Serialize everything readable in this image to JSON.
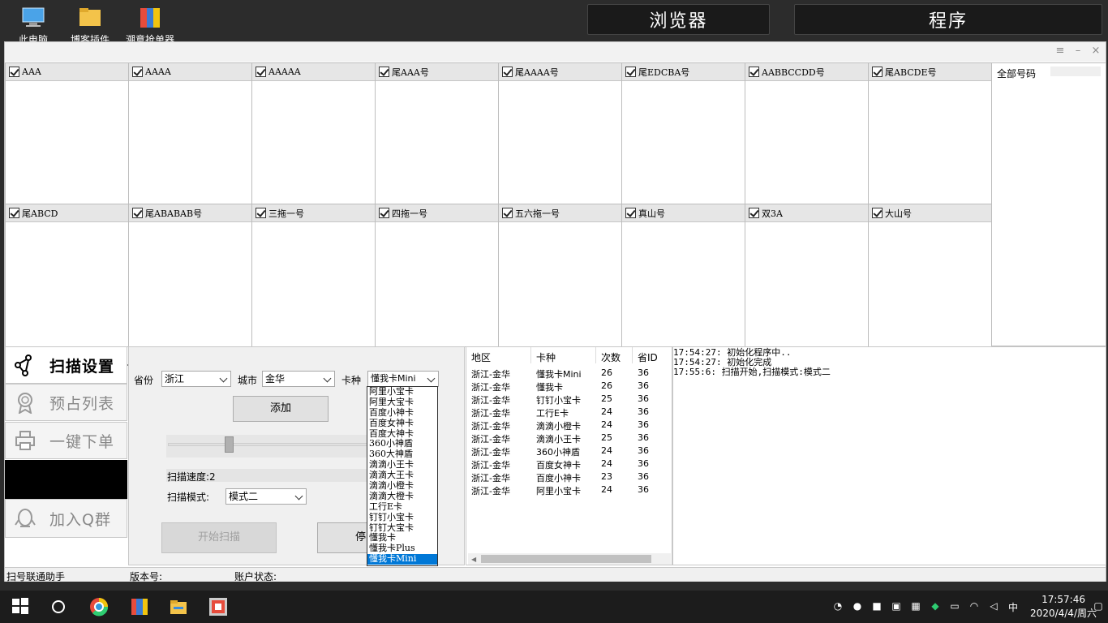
{
  "desktop": {
    "icons": [
      {
        "label": "此电脑",
        "icon": "computer-icon"
      },
      {
        "label": "博客插件",
        "icon": "folder-icon"
      },
      {
        "label": "溯意抢单器",
        "icon": "archive-icon"
      }
    ],
    "buttons": {
      "browser": "浏览器",
      "program": "程序"
    }
  },
  "window": {
    "controls": {
      "menu": "≡",
      "minimize": "–",
      "close": "×"
    }
  },
  "panes_row1": [
    "AAA",
    "AAAA",
    "AAAAA",
    "尾AAA号",
    "尾AAAA号",
    "尾EDCBA号",
    "AABBCCDD号",
    "尾ABCDE号"
  ],
  "panes_row2": [
    "尾ABCD",
    "尾ABABAB号",
    "三拖一号",
    "四拖一号",
    "五六拖一号",
    "真山号",
    "双3A",
    "大山号"
  ],
  "all_numbers_label": "全部号码",
  "nav": {
    "items": [
      "扫描设置",
      "预占列表",
      "一键下单",
      "加入Q群"
    ]
  },
  "settings": {
    "province_label": "省份",
    "province_value": "浙江",
    "city_label": "城市",
    "city_value": "金华",
    "card_label": "卡种",
    "card_value": "懂我卡Mini",
    "add_button": "添加",
    "speed_label": "扫描速度:2",
    "speed_value": 2,
    "mode_label": "扫描模式:",
    "mode_value": "模式二",
    "start_button": "开始扫描",
    "stop_button": "停"
  },
  "dropdown": {
    "options": [
      "阿里小宝卡",
      "阿里大宝卡",
      "百度小神卡",
      "百度女神卡",
      "百度大神卡",
      "360小神盾",
      "360大神盾",
      "滴滴小王卡",
      "滴滴大王卡",
      "滴滴小橙卡",
      "滴滴大橙卡",
      "工行E卡",
      "钉钉小宝卡",
      "钉钉大宝卡",
      "懂我卡",
      "懂我卡Plus",
      "懂我卡Mini"
    ],
    "selected": "懂我卡Mini"
  },
  "results": {
    "headers": [
      "地区",
      "卡种",
      "次数",
      "省ID"
    ],
    "rows": [
      [
        "浙江-金华",
        "懂我卡Mini",
        "26",
        "36"
      ],
      [
        "浙江-金华",
        "懂我卡",
        "26",
        "36"
      ],
      [
        "浙江-金华",
        "钉钉小宝卡",
        "25",
        "36"
      ],
      [
        "浙江-金华",
        "工行E卡",
        "24",
        "36"
      ],
      [
        "浙江-金华",
        "滴滴小橙卡",
        "24",
        "36"
      ],
      [
        "浙江-金华",
        "滴滴小王卡",
        "25",
        "36"
      ],
      [
        "浙江-金华",
        "360小神盾",
        "24",
        "36"
      ],
      [
        "浙江-金华",
        "百度女神卡",
        "24",
        "36"
      ],
      [
        "浙江-金华",
        "百度小神卡",
        "23",
        "36"
      ],
      [
        "浙江-金华",
        "阿里小宝卡",
        "24",
        "36"
      ]
    ]
  },
  "log": [
    "17:54:27: 初始化程序中..",
    "17:54:27: 初始化完成",
    "17:55:6: 扫描开始,扫描模式:模式二"
  ],
  "statusbar": {
    "app_name": "扫号联通助手",
    "version_label": "版本号:",
    "account_label": "账户状态:"
  },
  "taskbar": {
    "tray_ime": "中",
    "time": "17:57:46",
    "date": "2020/4/4/周六"
  },
  "colors": {
    "selection": "#0078d7",
    "pane_header": "#e6e6e6",
    "desktop_bg": "#2c2c2c",
    "taskbar_bg": "#1c1c1c"
  }
}
